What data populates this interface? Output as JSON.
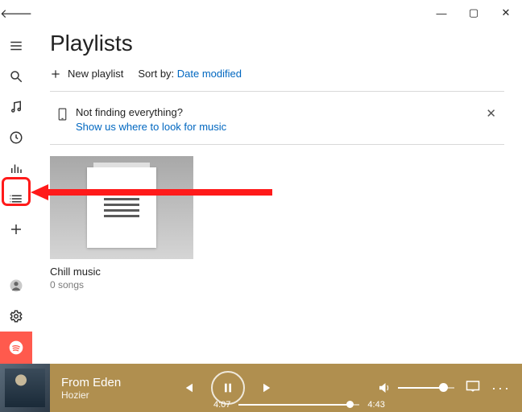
{
  "page_title": "Playlists",
  "toolbar": {
    "new_playlist_label": "New playlist",
    "sort_by_label": "Sort by:",
    "sort_by_value": "Date modified"
  },
  "info_banner": {
    "heading": "Not finding everything?",
    "link": "Show us where to look for music"
  },
  "playlists": [
    {
      "name": "Chill music",
      "count": "0 songs"
    }
  ],
  "player": {
    "track_title": "From Eden",
    "artist": "Hozier",
    "elapsed": "4:07",
    "duration": "4:43"
  }
}
